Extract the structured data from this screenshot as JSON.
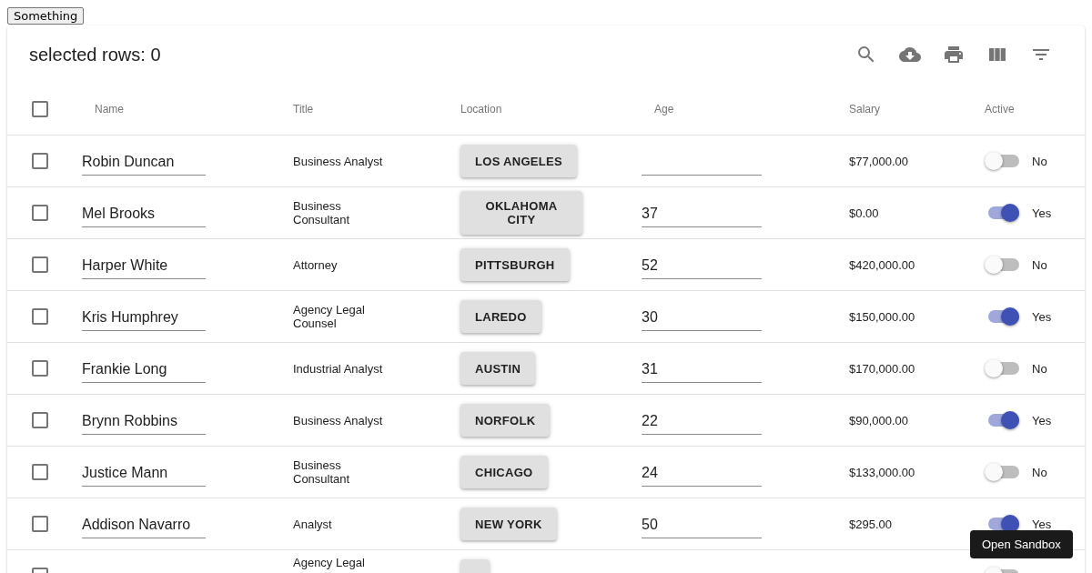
{
  "top_button": "Something",
  "toolbar": {
    "title": "selected rows: 0"
  },
  "table": {
    "all_selected": false,
    "columns": [
      "Name",
      "Title",
      "Location",
      "Age",
      "Salary",
      "Active"
    ],
    "rows": [
      {
        "selected": false,
        "name": "Robin Duncan",
        "title": "Business Analyst",
        "location": "LOS ANGELES",
        "salary": "$77,000.00",
        "active": false,
        "active_label": "No"
      },
      {
        "selected": false,
        "name": "Mel Brooks",
        "title": "Business Consultant",
        "location": "OKLAHOMA CITY",
        "age": "37",
        "salary": "$0.00",
        "active": true,
        "active_label": "Yes"
      },
      {
        "selected": false,
        "name": "Harper White",
        "title": "Attorney",
        "location": "PITTSBURGH",
        "age": "52",
        "salary": "$420,000.00",
        "active": false,
        "active_label": "No"
      },
      {
        "selected": false,
        "name": "Kris Humphrey",
        "title": "Agency Legal Counsel",
        "location": "LAREDO",
        "age": "30",
        "salary": "$150,000.00",
        "active": true,
        "active_label": "Yes"
      },
      {
        "selected": false,
        "name": "Frankie Long",
        "title": "Industrial Analyst",
        "location": "AUSTIN",
        "age": "31",
        "salary": "$170,000.00",
        "active": false,
        "active_label": "No"
      },
      {
        "selected": false,
        "name": "Brynn Robbins",
        "title": "Business Analyst",
        "location": "NORFOLK",
        "age": "22",
        "salary": "$90,000.00",
        "active": true,
        "active_label": "Yes"
      },
      {
        "selected": false,
        "name": "Justice Mann",
        "title": "Business Consultant",
        "location": "CHICAGO",
        "age": "24",
        "salary": "$133,000.00",
        "active": false,
        "active_label": "No"
      },
      {
        "selected": false,
        "name": "Addison Navarro",
        "title": "Analyst",
        "location": "NEW YORK",
        "age": "50",
        "salary": "$295.00",
        "active": true,
        "active_label": "Yes"
      },
      {
        "selected": false,
        "title": "Agency Legal",
        "active": false
      }
    ]
  },
  "tooltip": "Open Sandbox"
}
